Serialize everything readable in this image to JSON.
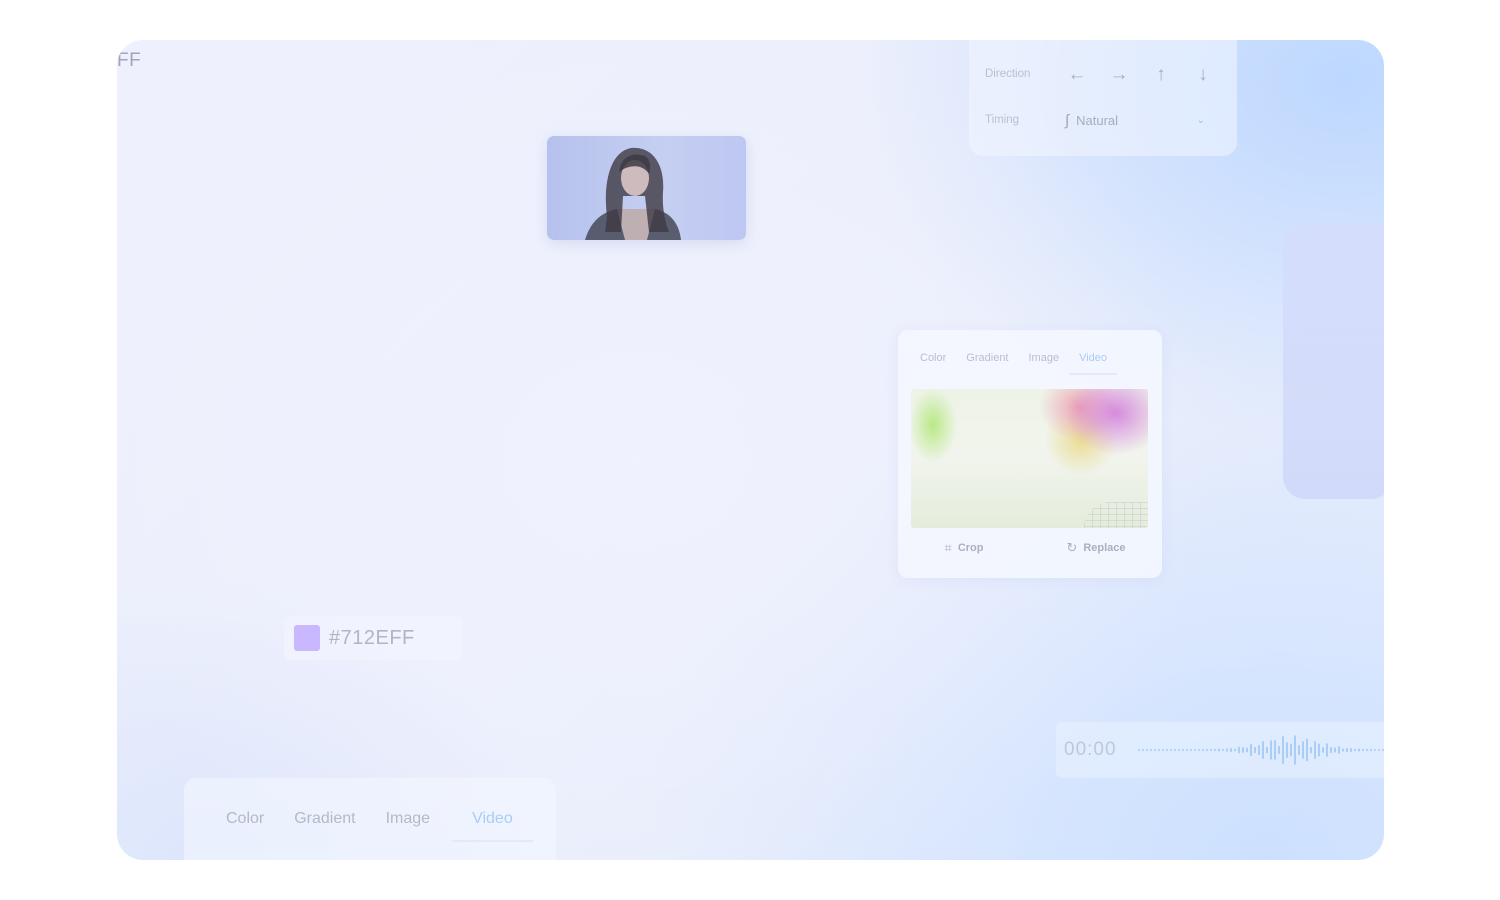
{
  "corner_label": "FF",
  "direction_panel": {
    "direction_label": "Direction",
    "arrows": [
      {
        "icon": "arrow-left-icon",
        "glyph": "←"
      },
      {
        "icon": "arrow-right-icon",
        "glyph": "→"
      },
      {
        "icon": "arrow-up-icon",
        "glyph": "↑"
      },
      {
        "icon": "arrow-down-icon",
        "glyph": "↓"
      }
    ],
    "timing_label": "Timing",
    "timing_value": "Natural"
  },
  "background_panel": {
    "tabs": [
      "Color",
      "Gradient",
      "Image",
      "Video"
    ],
    "active_tab": "Video",
    "crop_label": "Crop",
    "replace_label": "Replace"
  },
  "color_chip": {
    "hex": "#712EFF",
    "swatch_color": "#c9b7ff"
  },
  "audio": {
    "time": "00:00",
    "wave_color": "#a9cdf6"
  },
  "bottom_tabs": {
    "tabs": [
      "Color",
      "Gradient",
      "Image",
      "Video"
    ],
    "active_tab": "Video"
  },
  "colors": {
    "accent": "#a8cdf7",
    "muted_text": "#b3b9c8"
  }
}
